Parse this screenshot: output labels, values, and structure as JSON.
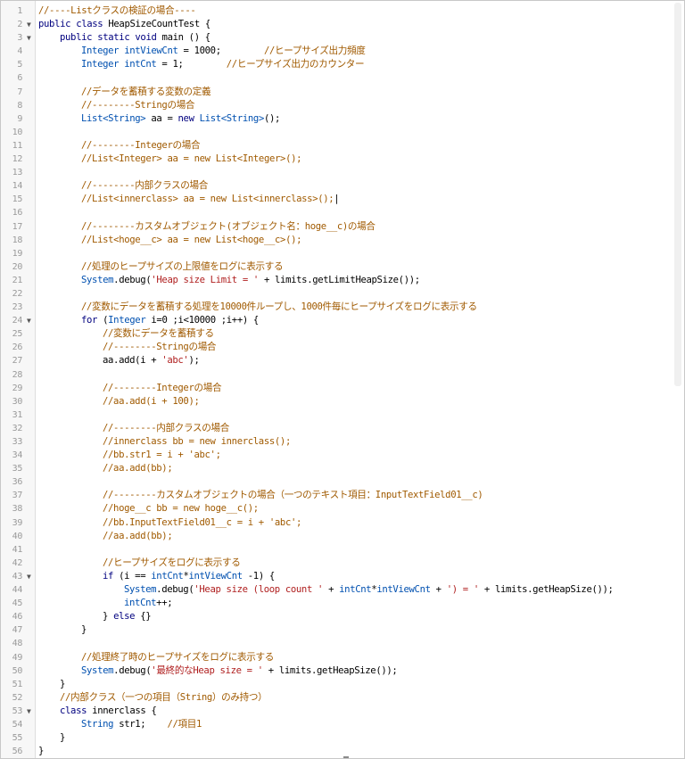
{
  "editor": {
    "lines": [
      {
        "n": "1",
        "fold": "",
        "indent": 0,
        "tokens": [
          {
            "t": "//----Listクラスの検証の場合----",
            "c": "cm"
          }
        ]
      },
      {
        "n": "2",
        "fold": "▼",
        "indent": 0,
        "tokens": [
          {
            "t": "public class ",
            "c": "kw"
          },
          {
            "t": "HeapSizeCountTest {",
            "c": "pl"
          }
        ]
      },
      {
        "n": "3",
        "fold": "▼",
        "indent": 1,
        "tokens": [
          {
            "t": "public static void ",
            "c": "kw"
          },
          {
            "t": "main () {",
            "c": "pl"
          }
        ]
      },
      {
        "n": "4",
        "fold": "",
        "indent": 2,
        "tokens": [
          {
            "t": "Integer intViewCnt",
            "c": "typ"
          },
          {
            "t": " = 1000;        ",
            "c": "pl"
          },
          {
            "t": "//ヒープサイズ出力頻度",
            "c": "cm"
          }
        ]
      },
      {
        "n": "5",
        "fold": "",
        "indent": 2,
        "tokens": [
          {
            "t": "Integer intCnt",
            "c": "typ"
          },
          {
            "t": " = 1;        ",
            "c": "pl"
          },
          {
            "t": "//ヒープサイズ出力のカウンター",
            "c": "cm"
          }
        ]
      },
      {
        "n": "6",
        "fold": "",
        "indent": 0,
        "tokens": []
      },
      {
        "n": "7",
        "fold": "",
        "indent": 2,
        "tokens": [
          {
            "t": "//データを蓄積する変数の定義",
            "c": "cm"
          }
        ]
      },
      {
        "n": "8",
        "fold": "",
        "indent": 2,
        "tokens": [
          {
            "t": "//--------Stringの場合",
            "c": "cm"
          }
        ]
      },
      {
        "n": "9",
        "fold": "",
        "indent": 2,
        "tokens": [
          {
            "t": "List<String>",
            "c": "typ"
          },
          {
            "t": " aa = ",
            "c": "pl"
          },
          {
            "t": "new ",
            "c": "kw"
          },
          {
            "t": "List<String>",
            "c": "typ"
          },
          {
            "t": "();",
            "c": "pl"
          }
        ]
      },
      {
        "n": "10",
        "fold": "",
        "indent": 0,
        "tokens": []
      },
      {
        "n": "11",
        "fold": "",
        "indent": 2,
        "tokens": [
          {
            "t": "//--------Integerの場合",
            "c": "cm"
          }
        ]
      },
      {
        "n": "12",
        "fold": "",
        "indent": 2,
        "tokens": [
          {
            "t": "//List<Integer> aa = new List<Integer>();",
            "c": "cm"
          }
        ]
      },
      {
        "n": "13",
        "fold": "",
        "indent": 0,
        "tokens": []
      },
      {
        "n": "14",
        "fold": "",
        "indent": 2,
        "tokens": [
          {
            "t": "//--------内部クラスの場合",
            "c": "cm"
          }
        ]
      },
      {
        "n": "15",
        "fold": "",
        "indent": 2,
        "tokens": [
          {
            "t": "//List<innerclass> aa = new List<innerclass>();",
            "c": "cm"
          },
          {
            "t": "|",
            "c": "pl"
          }
        ]
      },
      {
        "n": "16",
        "fold": "",
        "indent": 0,
        "tokens": []
      },
      {
        "n": "17",
        "fold": "",
        "indent": 2,
        "tokens": [
          {
            "t": "//--------カスタムオブジェクト(オブジェクト名：hoge__c)の場合",
            "c": "cm"
          }
        ]
      },
      {
        "n": "18",
        "fold": "",
        "indent": 2,
        "tokens": [
          {
            "t": "//List<hoge__c> aa = new List<hoge__c>();",
            "c": "cm"
          }
        ]
      },
      {
        "n": "19",
        "fold": "",
        "indent": 0,
        "tokens": []
      },
      {
        "n": "20",
        "fold": "",
        "indent": 2,
        "tokens": [
          {
            "t": "//処理のヒープサイズの上限値をログに表示する",
            "c": "cm"
          }
        ]
      },
      {
        "n": "21",
        "fold": "",
        "indent": 2,
        "tokens": [
          {
            "t": "System",
            "c": "typ"
          },
          {
            "t": ".debug(",
            "c": "pl"
          },
          {
            "t": "'Heap size Limit = '",
            "c": "str"
          },
          {
            "t": " + limits.getLimitHeapSize());",
            "c": "pl"
          }
        ]
      },
      {
        "n": "22",
        "fold": "",
        "indent": 0,
        "tokens": []
      },
      {
        "n": "23",
        "fold": "",
        "indent": 2,
        "tokens": [
          {
            "t": "//変数にデータを蓄積する処理を10000件ループし、1000件毎にヒープサイズをログに表示する",
            "c": "cm"
          }
        ]
      },
      {
        "n": "24",
        "fold": "▼",
        "indent": 2,
        "tokens": [
          {
            "t": "for ",
            "c": "kw"
          },
          {
            "t": "(",
            "c": "pl"
          },
          {
            "t": "Integer",
            "c": "typ"
          },
          {
            "t": " i=0 ;i<10000 ;i++) {",
            "c": "pl"
          }
        ]
      },
      {
        "n": "25",
        "fold": "",
        "indent": 3,
        "tokens": [
          {
            "t": "//変数にデータを蓄積する",
            "c": "cm"
          }
        ]
      },
      {
        "n": "26",
        "fold": "",
        "indent": 3,
        "tokens": [
          {
            "t": "//--------Stringの場合",
            "c": "cm"
          }
        ]
      },
      {
        "n": "27",
        "fold": "",
        "indent": 3,
        "tokens": [
          {
            "t": "aa.add(i + ",
            "c": "pl"
          },
          {
            "t": "'abc'",
            "c": "str"
          },
          {
            "t": ");",
            "c": "pl"
          }
        ]
      },
      {
        "n": "28",
        "fold": "",
        "indent": 0,
        "tokens": []
      },
      {
        "n": "29",
        "fold": "",
        "indent": 3,
        "tokens": [
          {
            "t": "//--------Integerの場合",
            "c": "cm"
          }
        ]
      },
      {
        "n": "30",
        "fold": "",
        "indent": 3,
        "tokens": [
          {
            "t": "//aa.add(i + 100);",
            "c": "cm"
          }
        ]
      },
      {
        "n": "31",
        "fold": "",
        "indent": 0,
        "tokens": []
      },
      {
        "n": "32",
        "fold": "",
        "indent": 3,
        "tokens": [
          {
            "t": "//--------内部クラスの場合",
            "c": "cm"
          }
        ]
      },
      {
        "n": "33",
        "fold": "",
        "indent": 3,
        "tokens": [
          {
            "t": "//innerclass bb = new innerclass();",
            "c": "cm"
          }
        ]
      },
      {
        "n": "34",
        "fold": "",
        "indent": 3,
        "tokens": [
          {
            "t": "//bb.str1 = i + 'abc';",
            "c": "cm"
          }
        ]
      },
      {
        "n": "35",
        "fold": "",
        "indent": 3,
        "tokens": [
          {
            "t": "//aa.add(bb);",
            "c": "cm"
          }
        ]
      },
      {
        "n": "36",
        "fold": "",
        "indent": 0,
        "tokens": []
      },
      {
        "n": "37",
        "fold": "",
        "indent": 3,
        "tokens": [
          {
            "t": "//--------カスタムオブジェクトの場合（一つのテキスト項目：InputTextField01__c)",
            "c": "cm"
          }
        ]
      },
      {
        "n": "38",
        "fold": "",
        "indent": 3,
        "tokens": [
          {
            "t": "//hoge__c bb = new hoge__c();",
            "c": "cm"
          }
        ]
      },
      {
        "n": "39",
        "fold": "",
        "indent": 3,
        "tokens": [
          {
            "t": "//bb.InputTextField01__c = i + 'abc';",
            "c": "cm"
          }
        ]
      },
      {
        "n": "40",
        "fold": "",
        "indent": 3,
        "tokens": [
          {
            "t": "//aa.add(bb);",
            "c": "cm"
          }
        ]
      },
      {
        "n": "41",
        "fold": "",
        "indent": 0,
        "tokens": []
      },
      {
        "n": "42",
        "fold": "",
        "indent": 3,
        "tokens": [
          {
            "t": "//ヒープサイズをログに表示する",
            "c": "cm"
          }
        ]
      },
      {
        "n": "43",
        "fold": "▼",
        "indent": 3,
        "tokens": [
          {
            "t": "if ",
            "c": "kw"
          },
          {
            "t": "(i == ",
            "c": "pl"
          },
          {
            "t": "intCnt",
            "c": "typ"
          },
          {
            "t": "*",
            "c": "pl"
          },
          {
            "t": "intViewCnt",
            "c": "typ"
          },
          {
            "t": " -1) {",
            "c": "pl"
          }
        ]
      },
      {
        "n": "44",
        "fold": "",
        "indent": 4,
        "tokens": [
          {
            "t": "System",
            "c": "typ"
          },
          {
            "t": ".debug(",
            "c": "pl"
          },
          {
            "t": "'Heap size (loop count '",
            "c": "str"
          },
          {
            "t": " + ",
            "c": "pl"
          },
          {
            "t": "intCnt",
            "c": "typ"
          },
          {
            "t": "*",
            "c": "pl"
          },
          {
            "t": "intViewCnt",
            "c": "typ"
          },
          {
            "t": " + ",
            "c": "pl"
          },
          {
            "t": "') = '",
            "c": "str"
          },
          {
            "t": " + limits.getHeapSize());",
            "c": "pl"
          }
        ]
      },
      {
        "n": "45",
        "fold": "",
        "indent": 4,
        "tokens": [
          {
            "t": "intCnt",
            "c": "typ"
          },
          {
            "t": "++;",
            "c": "pl"
          }
        ]
      },
      {
        "n": "46",
        "fold": "",
        "indent": 3,
        "tokens": [
          {
            "t": "} ",
            "c": "pl"
          },
          {
            "t": "else ",
            "c": "kw"
          },
          {
            "t": "{}",
            "c": "pl"
          }
        ]
      },
      {
        "n": "47",
        "fold": "",
        "indent": 2,
        "tokens": [
          {
            "t": "}",
            "c": "pl"
          }
        ]
      },
      {
        "n": "48",
        "fold": "",
        "indent": 0,
        "tokens": []
      },
      {
        "n": "49",
        "fold": "",
        "indent": 2,
        "tokens": [
          {
            "t": "//処理終了時のヒープサイズをログに表示する",
            "c": "cm"
          }
        ]
      },
      {
        "n": "50",
        "fold": "",
        "indent": 2,
        "tokens": [
          {
            "t": "System",
            "c": "typ"
          },
          {
            "t": ".debug(",
            "c": "pl"
          },
          {
            "t": "'最終的なHeap size = '",
            "c": "str"
          },
          {
            "t": " + limits.getHeapSize());",
            "c": "pl"
          }
        ]
      },
      {
        "n": "51",
        "fold": "",
        "indent": 1,
        "tokens": [
          {
            "t": "}",
            "c": "pl"
          }
        ]
      },
      {
        "n": "52",
        "fold": "",
        "indent": 1,
        "tokens": [
          {
            "t": "//内部クラス（一つの項目（String）のみ持つ）",
            "c": "cm"
          }
        ]
      },
      {
        "n": "53",
        "fold": "▼",
        "indent": 1,
        "tokens": [
          {
            "t": "class ",
            "c": "kw"
          },
          {
            "t": "innerclass {",
            "c": "pl"
          }
        ]
      },
      {
        "n": "54",
        "fold": "",
        "indent": 2,
        "tokens": [
          {
            "t": "String",
            "c": "typ"
          },
          {
            "t": " str1;    ",
            "c": "pl"
          },
          {
            "t": "//項目1",
            "c": "cm"
          }
        ]
      },
      {
        "n": "55",
        "fold": "",
        "indent": 1,
        "tokens": [
          {
            "t": "}",
            "c": "pl"
          }
        ]
      },
      {
        "n": "56",
        "fold": "",
        "indent": 0,
        "tokens": [
          {
            "t": "}",
            "c": "pl"
          }
        ]
      }
    ]
  },
  "colors": {
    "keyword": "#00007f",
    "type": "#0050b0",
    "comment": "#a05a00",
    "string": "#b02020",
    "plain": "#000000",
    "line_number": "#9a9a9a"
  },
  "icons": {
    "fold": "fold-arrow-icon"
  }
}
